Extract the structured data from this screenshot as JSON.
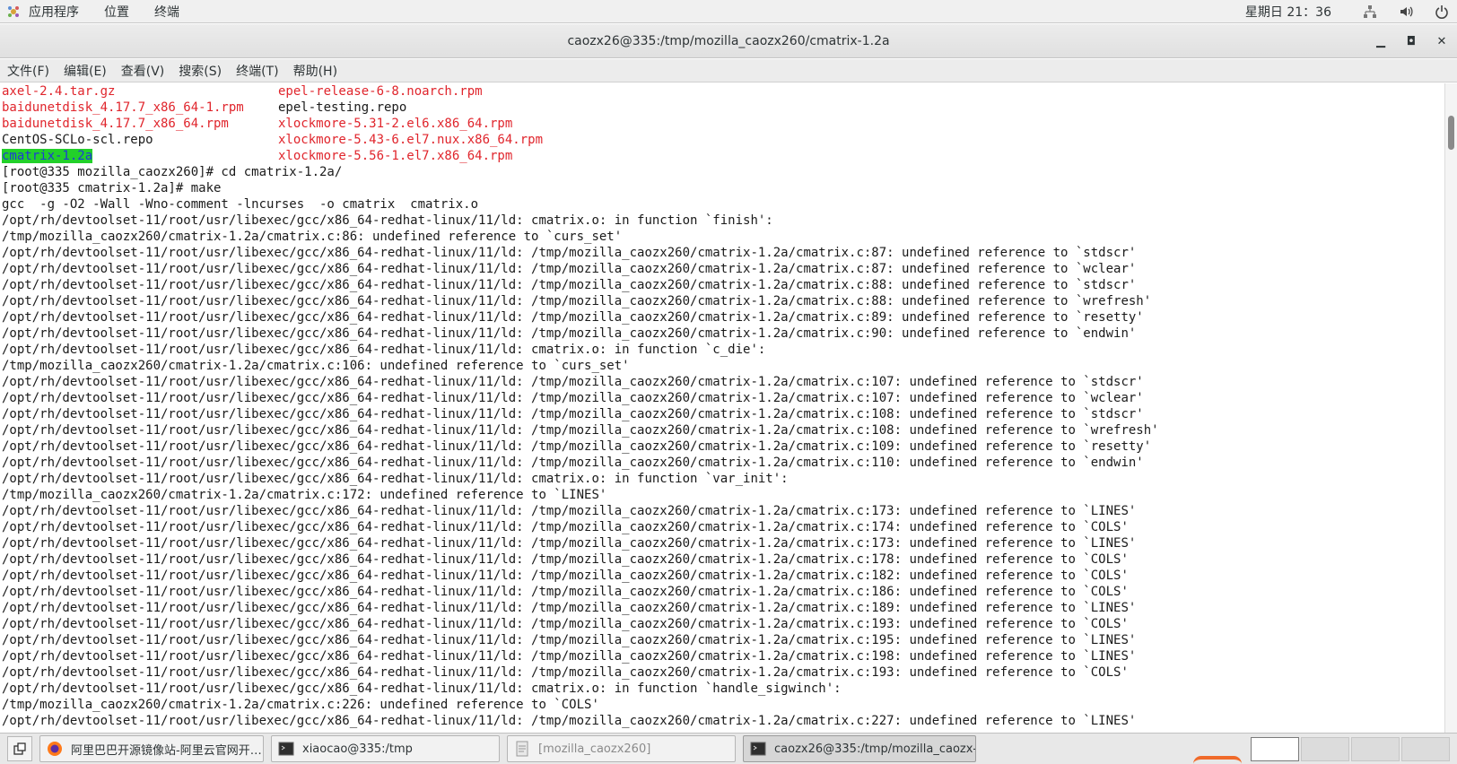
{
  "top_panel": {
    "menus": [
      "应用程序",
      "位置",
      "终端"
    ],
    "clock": "星期日 21：36",
    "icons": [
      "apps-icon",
      "network-icon",
      "volume-icon",
      "power-icon"
    ]
  },
  "window": {
    "title": "caozx26@335:/tmp/mozilla_caozx260/cmatrix-1.2a",
    "controls": [
      "minimize-icon",
      "maximize-icon",
      "close-icon"
    ]
  },
  "menubar": [
    "文件(F)",
    "编辑(E)",
    "查看(V)",
    "搜索(S)",
    "终端(T)",
    "帮助(H)"
  ],
  "terminal": {
    "ls_output": [
      {
        "left": "axel-2.4.tar.gz",
        "right": "epel-release-6-8.noarch.rpm",
        "left_color": "red",
        "right_color": "red"
      },
      {
        "left": "baidunetdisk_4.17.7_x86_64-1.rpm",
        "right": "epel-testing.repo",
        "left_color": "red",
        "right_color": "normal"
      },
      {
        "left": "baidunetdisk_4.17.7_x86_64.rpm",
        "right": "xlockmore-5.31-2.el6.x86_64.rpm",
        "left_color": "red",
        "right_color": "red"
      },
      {
        "left": "CentOS-SCLo-scl.repo",
        "right": "xlockmore-5.43-6.el7.nux.x86_64.rpm",
        "left_color": "normal",
        "right_color": "red"
      },
      {
        "left": "cmatrix-1.2a",
        "right": "xlockmore-5.56-1.el7.x86_64.rpm",
        "left_color": "highlight",
        "right_color": "red"
      }
    ],
    "lines": [
      "[root@335 mozilla_caozx260]# cd cmatrix-1.2a/",
      "[root@335 cmatrix-1.2a]# make",
      "gcc  -g -O2 -Wall -Wno-comment -lncurses  -o cmatrix  cmatrix.o",
      "/opt/rh/devtoolset-11/root/usr/libexec/gcc/x86_64-redhat-linux/11/ld: cmatrix.o: in function `finish':",
      "/tmp/mozilla_caozx260/cmatrix-1.2a/cmatrix.c:86: undefined reference to `curs_set'",
      "/opt/rh/devtoolset-11/root/usr/libexec/gcc/x86_64-redhat-linux/11/ld: /tmp/mozilla_caozx260/cmatrix-1.2a/cmatrix.c:87: undefined reference to `stdscr'",
      "/opt/rh/devtoolset-11/root/usr/libexec/gcc/x86_64-redhat-linux/11/ld: /tmp/mozilla_caozx260/cmatrix-1.2a/cmatrix.c:87: undefined reference to `wclear'",
      "/opt/rh/devtoolset-11/root/usr/libexec/gcc/x86_64-redhat-linux/11/ld: /tmp/mozilla_caozx260/cmatrix-1.2a/cmatrix.c:88: undefined reference to `stdscr'",
      "/opt/rh/devtoolset-11/root/usr/libexec/gcc/x86_64-redhat-linux/11/ld: /tmp/mozilla_caozx260/cmatrix-1.2a/cmatrix.c:88: undefined reference to `wrefresh'",
      "/opt/rh/devtoolset-11/root/usr/libexec/gcc/x86_64-redhat-linux/11/ld: /tmp/mozilla_caozx260/cmatrix-1.2a/cmatrix.c:89: undefined reference to `resetty'",
      "/opt/rh/devtoolset-11/root/usr/libexec/gcc/x86_64-redhat-linux/11/ld: /tmp/mozilla_caozx260/cmatrix-1.2a/cmatrix.c:90: undefined reference to `endwin'",
      "/opt/rh/devtoolset-11/root/usr/libexec/gcc/x86_64-redhat-linux/11/ld: cmatrix.o: in function `c_die':",
      "/tmp/mozilla_caozx260/cmatrix-1.2a/cmatrix.c:106: undefined reference to `curs_set'",
      "/opt/rh/devtoolset-11/root/usr/libexec/gcc/x86_64-redhat-linux/11/ld: /tmp/mozilla_caozx260/cmatrix-1.2a/cmatrix.c:107: undefined reference to `stdscr'",
      "/opt/rh/devtoolset-11/root/usr/libexec/gcc/x86_64-redhat-linux/11/ld: /tmp/mozilla_caozx260/cmatrix-1.2a/cmatrix.c:107: undefined reference to `wclear'",
      "/opt/rh/devtoolset-11/root/usr/libexec/gcc/x86_64-redhat-linux/11/ld: /tmp/mozilla_caozx260/cmatrix-1.2a/cmatrix.c:108: undefined reference to `stdscr'",
      "/opt/rh/devtoolset-11/root/usr/libexec/gcc/x86_64-redhat-linux/11/ld: /tmp/mozilla_caozx260/cmatrix-1.2a/cmatrix.c:108: undefined reference to `wrefresh'",
      "/opt/rh/devtoolset-11/root/usr/libexec/gcc/x86_64-redhat-linux/11/ld: /tmp/mozilla_caozx260/cmatrix-1.2a/cmatrix.c:109: undefined reference to `resetty'",
      "/opt/rh/devtoolset-11/root/usr/libexec/gcc/x86_64-redhat-linux/11/ld: /tmp/mozilla_caozx260/cmatrix-1.2a/cmatrix.c:110: undefined reference to `endwin'",
      "/opt/rh/devtoolset-11/root/usr/libexec/gcc/x86_64-redhat-linux/11/ld: cmatrix.o: in function `var_init':",
      "/tmp/mozilla_caozx260/cmatrix-1.2a/cmatrix.c:172: undefined reference to `LINES'",
      "/opt/rh/devtoolset-11/root/usr/libexec/gcc/x86_64-redhat-linux/11/ld: /tmp/mozilla_caozx260/cmatrix-1.2a/cmatrix.c:173: undefined reference to `LINES'",
      "/opt/rh/devtoolset-11/root/usr/libexec/gcc/x86_64-redhat-linux/11/ld: /tmp/mozilla_caozx260/cmatrix-1.2a/cmatrix.c:174: undefined reference to `COLS'",
      "/opt/rh/devtoolset-11/root/usr/libexec/gcc/x86_64-redhat-linux/11/ld: /tmp/mozilla_caozx260/cmatrix-1.2a/cmatrix.c:173: undefined reference to `LINES'",
      "/opt/rh/devtoolset-11/root/usr/libexec/gcc/x86_64-redhat-linux/11/ld: /tmp/mozilla_caozx260/cmatrix-1.2a/cmatrix.c:178: undefined reference to `COLS'",
      "/opt/rh/devtoolset-11/root/usr/libexec/gcc/x86_64-redhat-linux/11/ld: /tmp/mozilla_caozx260/cmatrix-1.2a/cmatrix.c:182: undefined reference to `COLS'",
      "/opt/rh/devtoolset-11/root/usr/libexec/gcc/x86_64-redhat-linux/11/ld: /tmp/mozilla_caozx260/cmatrix-1.2a/cmatrix.c:186: undefined reference to `COLS'",
      "/opt/rh/devtoolset-11/root/usr/libexec/gcc/x86_64-redhat-linux/11/ld: /tmp/mozilla_caozx260/cmatrix-1.2a/cmatrix.c:189: undefined reference to `LINES'",
      "/opt/rh/devtoolset-11/root/usr/libexec/gcc/x86_64-redhat-linux/11/ld: /tmp/mozilla_caozx260/cmatrix-1.2a/cmatrix.c:193: undefined reference to `COLS'",
      "/opt/rh/devtoolset-11/root/usr/libexec/gcc/x86_64-redhat-linux/11/ld: /tmp/mozilla_caozx260/cmatrix-1.2a/cmatrix.c:195: undefined reference to `LINES'",
      "/opt/rh/devtoolset-11/root/usr/libexec/gcc/x86_64-redhat-linux/11/ld: /tmp/mozilla_caozx260/cmatrix-1.2a/cmatrix.c:198: undefined reference to `LINES'",
      "/opt/rh/devtoolset-11/root/usr/libexec/gcc/x86_64-redhat-linux/11/ld: /tmp/mozilla_caozx260/cmatrix-1.2a/cmatrix.c:193: undefined reference to `COLS'",
      "/opt/rh/devtoolset-11/root/usr/libexec/gcc/x86_64-redhat-linux/11/ld: cmatrix.o: in function `handle_sigwinch':",
      "/tmp/mozilla_caozx260/cmatrix-1.2a/cmatrix.c:226: undefined reference to `COLS'",
      "/opt/rh/devtoolset-11/root/usr/libexec/gcc/x86_64-redhat-linux/11/ld: /tmp/mozilla_caozx260/cmatrix-1.2a/cmatrix.c:227: undefined reference to `LINES'"
    ]
  },
  "taskbar": {
    "tasks": [
      {
        "label": "阿里巴巴开源镜像站-阿里云官网开…",
        "icon": "firefox-icon",
        "state": "normal"
      },
      {
        "label": "xiaocao@335:/tmp",
        "icon": "terminal-icon",
        "state": "normal"
      },
      {
        "label": "[mozilla_caozx260]",
        "icon": "file-manager-icon",
        "state": "dim"
      },
      {
        "label": "caozx26@335:/tmp/mozilla_caozx-…",
        "icon": "terminal-icon",
        "state": "active"
      }
    ],
    "workspace_count": 4
  },
  "colors": {
    "terminal_bg": "#ffffff",
    "ls_red": "#e0252c",
    "highlight_bg": "#22d02a",
    "highlight_fg": "#1f3bd6"
  }
}
